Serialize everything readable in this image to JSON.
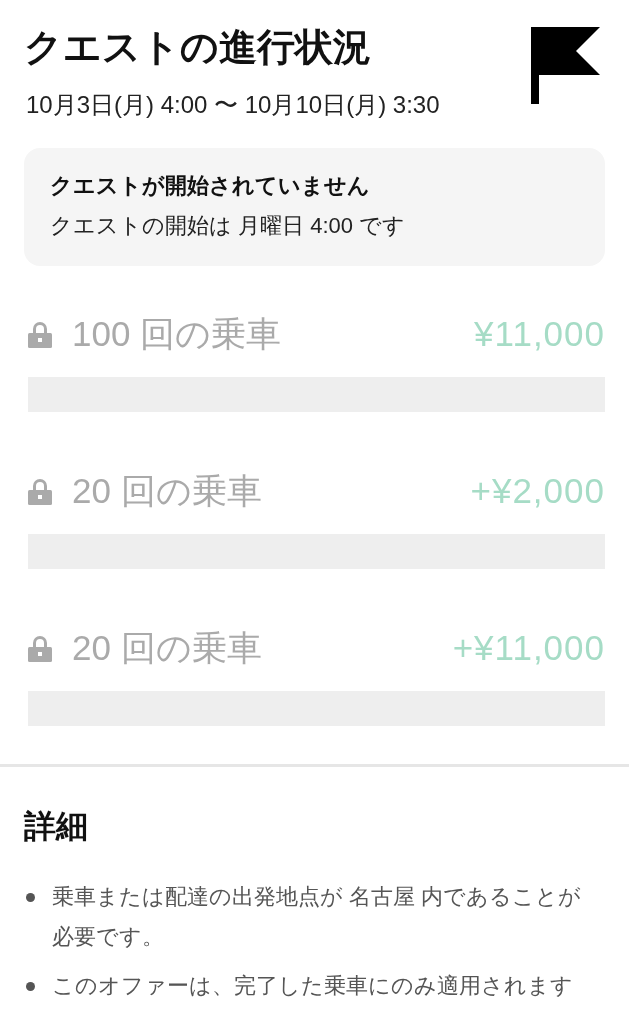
{
  "header": {
    "title": "クエストの進行状況",
    "date_range": "10月3日(月) 4:00 〜 10月10日(月) 3:30"
  },
  "notice": {
    "title": "クエストが開始されていません",
    "message": "クエストの開始は 月曜日 4:00 です"
  },
  "tiers": [
    {
      "label": "100 回の乗車",
      "reward": "¥11,000",
      "locked": true
    },
    {
      "label": "20 回の乗車",
      "reward": "+¥2,000",
      "locked": true
    },
    {
      "label": "20 回の乗車",
      "reward": "+¥11,000",
      "locked": true
    }
  ],
  "details": {
    "title": "詳細",
    "items": [
      "乗車または配達の出発地点が 名古屋 内であることが必要です。",
      "このオファーは、完了した乗車にのみ適用されます"
    ]
  }
}
